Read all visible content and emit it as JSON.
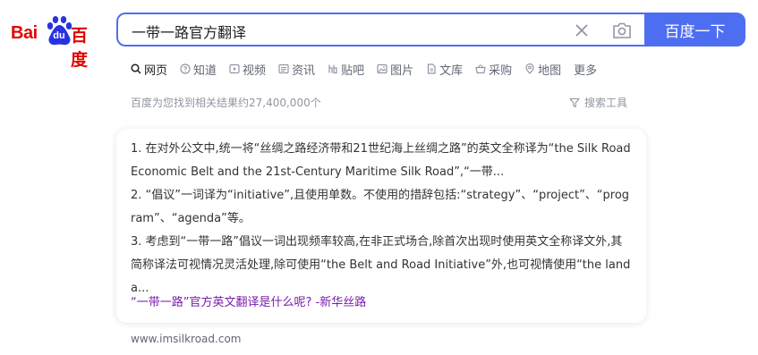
{
  "brand": {
    "bai": "Bai",
    "du": "du",
    "cn": "百度",
    "colors": {
      "red": "#e10601",
      "blue": "#4e6ef2"
    }
  },
  "search": {
    "query": "一带一路官方翻译",
    "button_label": "百度一下",
    "clear_icon": "close-icon",
    "camera_icon": "camera-icon"
  },
  "tabs": [
    {
      "label": "网页",
      "icon": "search-icon",
      "active": true
    },
    {
      "label": "知道",
      "icon": "question-icon"
    },
    {
      "label": "视频",
      "icon": "video-icon"
    },
    {
      "label": "资讯",
      "icon": "news-icon"
    },
    {
      "label": "贴吧",
      "icon": "tieba-icon"
    },
    {
      "label": "图片",
      "icon": "image-icon"
    },
    {
      "label": "文库",
      "icon": "document-icon"
    },
    {
      "label": "采购",
      "icon": "basket-icon"
    },
    {
      "label": "地图",
      "icon": "map-pin-icon"
    },
    {
      "label": "更多"
    }
  ],
  "results_info": {
    "count_text": "百度为您找到相关结果约27,400,000个",
    "tools_label": "搜索工具"
  },
  "result_card": {
    "items": [
      "1. 在对外公文中,统一将“丝绸之路经济带和21世纪海上丝绸之路”的英文全称译为“the Silk Road Economic Belt and the 21st-Century Maritime Silk Road”,“一带...",
      "2. “倡议”一词译为“initiative”,且使用单数。不使用的措辞包括:“strategy”、“project”、“program”、“agenda”等。",
      "3. 考虑到“一带一路”倡议一词出现频率较高,在非正式场合,除首次出现时使用英文全称译文外,其简称译法可视情况灵活处理,除可使用“the Belt and Road Initiative”外,也可视情使用“the land a..."
    ],
    "link_text": "“一带一路”官方英文翻译是什么呢? -新华丝路"
  },
  "source_url": "www.imsilkroad.com"
}
